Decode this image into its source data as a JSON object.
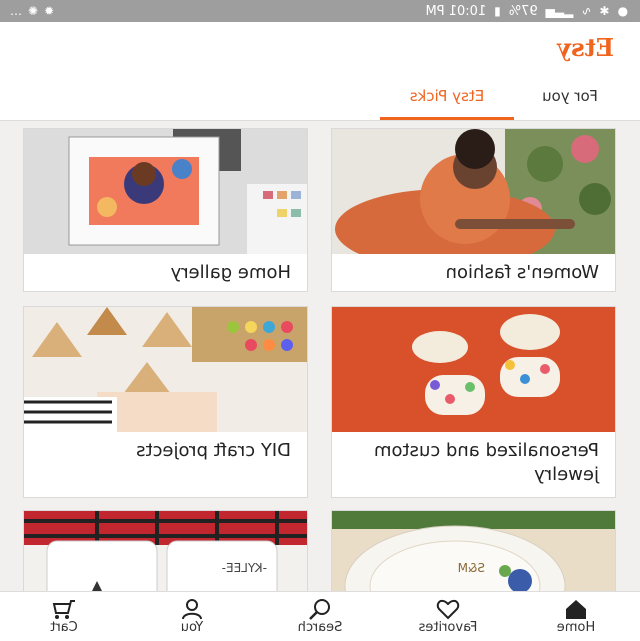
{
  "status_bar": {
    "time": "10:01 PM",
    "battery": "97%",
    "overflow": "…"
  },
  "app": {
    "logo": "Etsy"
  },
  "tabs": [
    {
      "label": "For you"
    },
    {
      "label": "Etsy Picks",
      "active": true
    }
  ],
  "cards": [
    {
      "label": "Women's fashion"
    },
    {
      "label": "Home gallery"
    },
    {
      "label": "Personalized and custom jewelry"
    },
    {
      "label": "DIY craft projects"
    },
    {
      "label": ""
    },
    {
      "label": ""
    }
  ],
  "mug_text": "-KYLEE-",
  "dish_text": "S&M",
  "bottom_nav": [
    {
      "label": "Home",
      "icon": "home-icon",
      "active": true
    },
    {
      "label": "Favorites",
      "icon": "heart-icon"
    },
    {
      "label": "Search",
      "icon": "search-icon"
    },
    {
      "label": "You",
      "icon": "user-icon"
    },
    {
      "label": "Cart",
      "icon": "cart-icon"
    }
  ],
  "colors": {
    "accent": "#f1641e",
    "status_bar": "#9e9e9e"
  }
}
